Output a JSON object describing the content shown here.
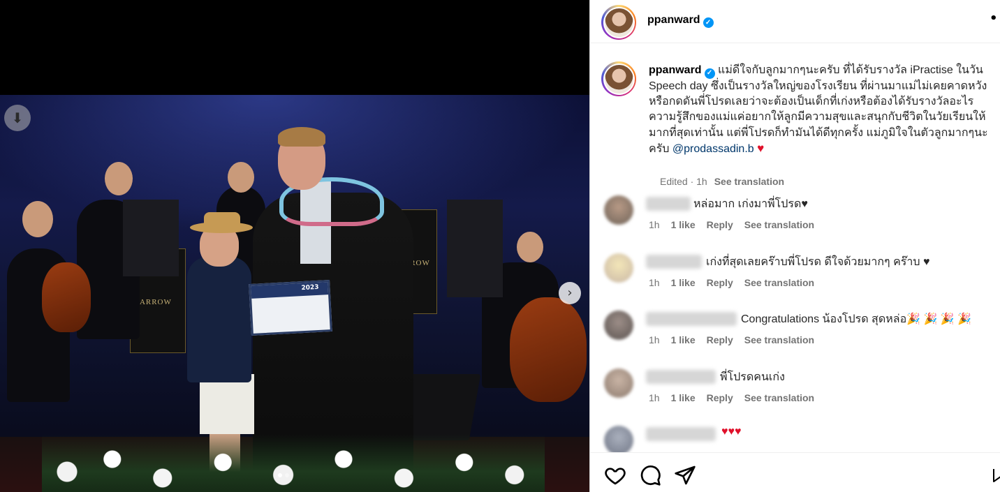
{
  "post": {
    "media": {
      "download_label": "⬇",
      "next_label": "›",
      "dots_count": 2,
      "active_dot": 0,
      "banner_words": [
        "HARROW",
        "HARROW"
      ],
      "certificate_year": "2023"
    },
    "header": {
      "username": "ppanward",
      "verified": true,
      "more": "•"
    },
    "caption": {
      "username": "ppanward",
      "text": "แม่ดีใจกับลูกมากๆนะครับ ที่ได้รับรางวัล iPractise ในวัน Speech day ซึ่งเป็นรางวัลใหญ่ของโรงเรียน ที่ผ่านมาแม่ไม่เคยคาดหวังหรือกดดันพี่โปรดเลยว่าจะต้องเป็นเด็กที่เก่งหรือต้องได้รับรางวัลอะไร ความรู้สึกของแม่แค่อยากให้ลูกมีความสุขและสนุกกับชีวิตในวัยเรียนให้มากที่สุดเท่านั้น แต่พี่โปรดก็ทำมันได้ดีทุกครั้ง แม่ภูมิใจในตัวลูกมากๆนะครับ",
      "mention": "@prodassadin.b",
      "heart": "♥",
      "edited": "Edited · 1h",
      "see_translation": "See translation"
    },
    "comments": [
      {
        "text": "หล่อมาก เก่งมาพี่โปรด♥",
        "time": "1h",
        "likes": "1 like",
        "reply": "Reply",
        "see_translation": "See translation"
      },
      {
        "text": "เก่งที่สุดเลยคร๊าบพี่โปรด ดีใจด้วยมากๆ คร๊าบ ♥",
        "time": "1h",
        "likes": "1 like",
        "reply": "Reply",
        "see_translation": "See translation"
      },
      {
        "text": "Congratulations น้องโปรด สุดหล่อ🎉 🎉 🎉 🎉",
        "time": "1h",
        "likes": "1 like",
        "reply": "Reply",
        "see_translation": "See translation"
      },
      {
        "text": "พี่โปรดคนเก่ง",
        "time": "1h",
        "likes": "1 like",
        "reply": "Reply",
        "see_translation": "See translation"
      },
      {
        "text": "♥♥♥",
        "time": "",
        "likes": "",
        "reply": "",
        "see_translation": ""
      }
    ],
    "actions": {
      "like_icon": "heart-outline-icon",
      "comment_icon": "comment-bubble-icon",
      "share_icon": "paper-plane-icon",
      "save_icon": "bookmark-icon"
    },
    "colors": {
      "verified": "#0095f6",
      "heart": "#e0112b",
      "mention": "#00376b",
      "meta": "#737373"
    }
  }
}
